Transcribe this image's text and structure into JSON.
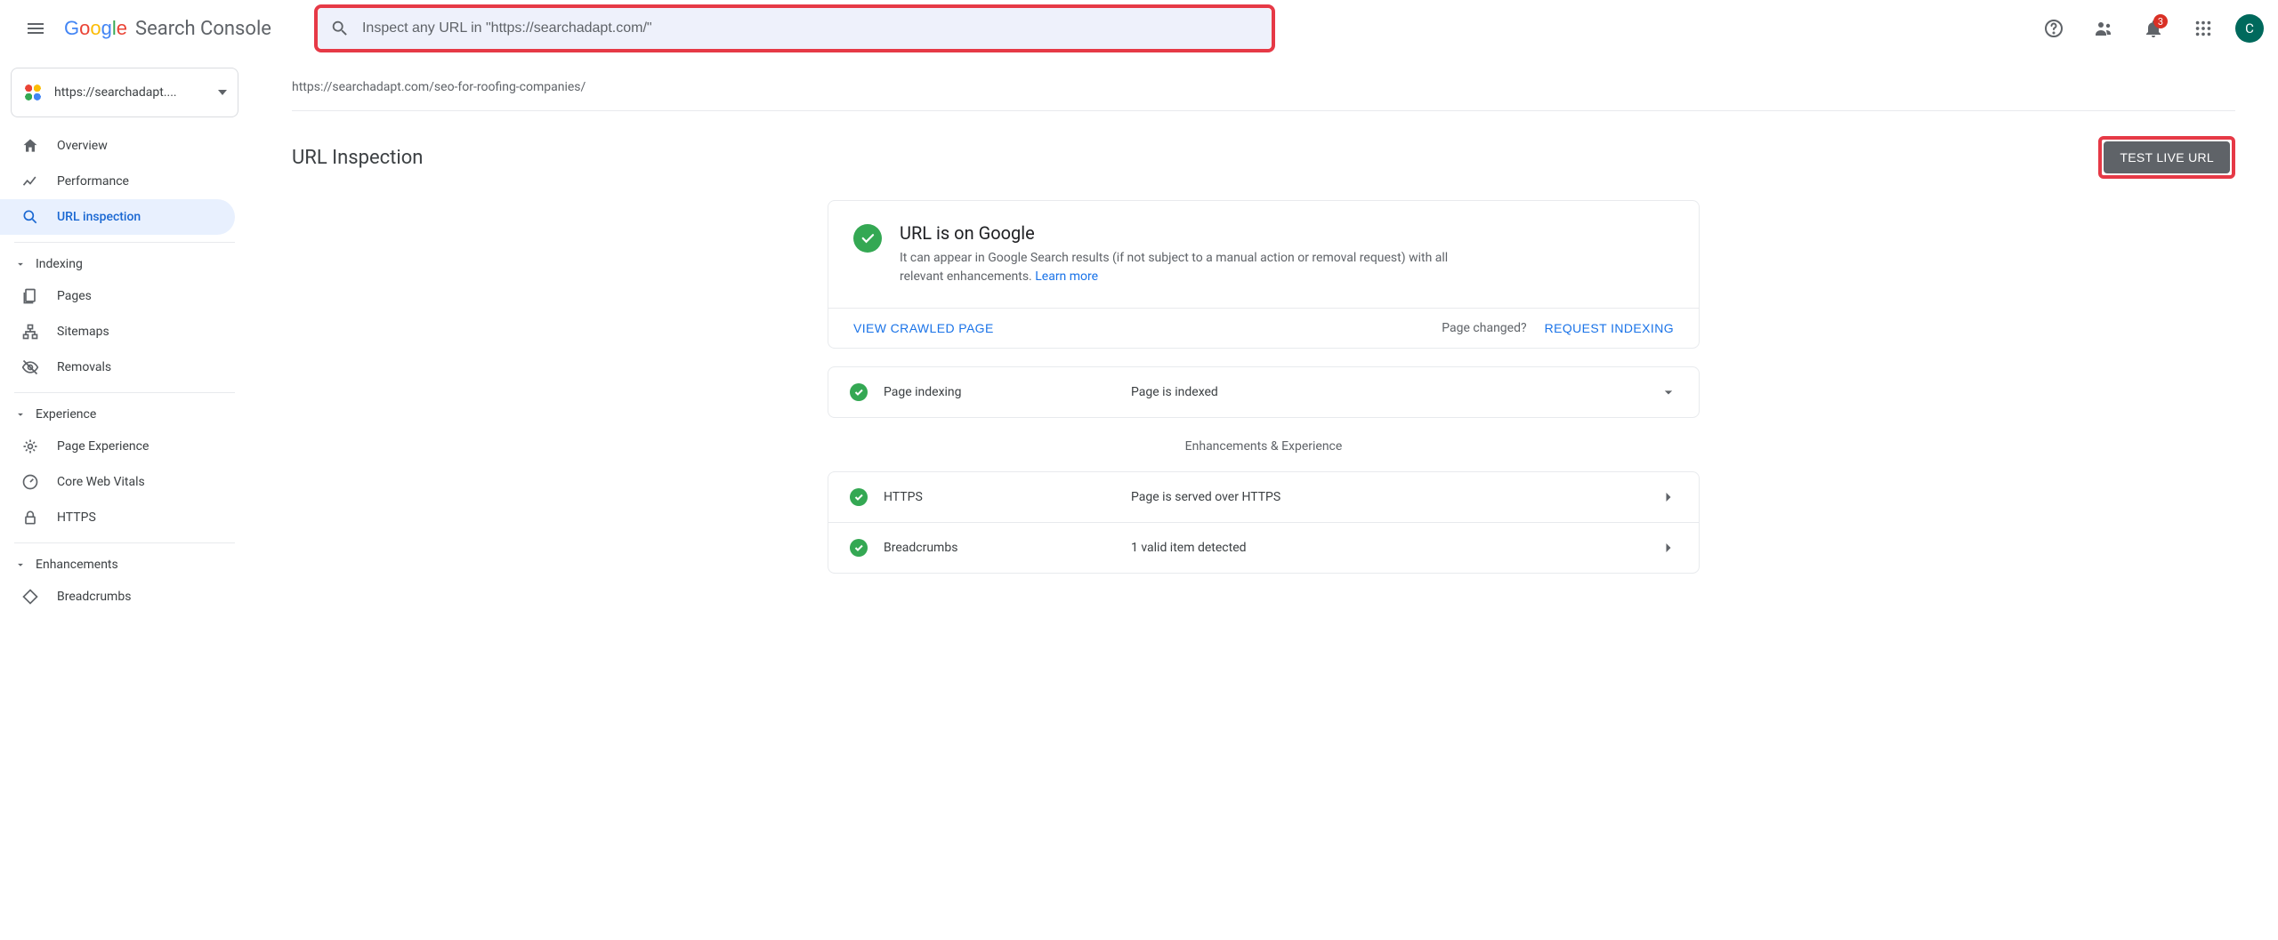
{
  "header": {
    "product_name": "Search Console",
    "search_placeholder": "Inspect any URL in \"https://searchadapt.com/\"",
    "notification_count": "3",
    "avatar_letter": "C"
  },
  "sidebar": {
    "property_label": "https://searchadapt....",
    "items": {
      "overview": "Overview",
      "performance": "Performance",
      "url_inspection": "URL inspection"
    },
    "groups": {
      "indexing": {
        "title": "Indexing",
        "pages": "Pages",
        "sitemaps": "Sitemaps",
        "removals": "Removals"
      },
      "experience": {
        "title": "Experience",
        "page_experience": "Page Experience",
        "core_web_vitals": "Core Web Vitals",
        "https": "HTTPS"
      },
      "enhancements": {
        "title": "Enhancements",
        "breadcrumbs": "Breadcrumbs"
      }
    }
  },
  "main": {
    "inspected_url": "https://searchadapt.com/seo-for-roofing-companies/",
    "page_title": "URL Inspection",
    "test_live_btn": "TEST LIVE URL",
    "hero": {
      "title": "URL is on Google",
      "subtitle_a": "It can appear in Google Search results (if not subject to a manual action or removal request) with all relevant enhancements. ",
      "learn_more": "Learn more"
    },
    "actions": {
      "view_crawled": "VIEW CRAWLED PAGE",
      "page_changed": "Page changed?",
      "request_indexing": "REQUEST INDEXING"
    },
    "indexing_row": {
      "label": "Page indexing",
      "value": "Page is indexed"
    },
    "enhancements_section": "Enhancements & Experience",
    "https_row": {
      "label": "HTTPS",
      "value": "Page is served over HTTPS"
    },
    "breadcrumbs_row": {
      "label": "Breadcrumbs",
      "value": "1 valid item detected"
    }
  }
}
